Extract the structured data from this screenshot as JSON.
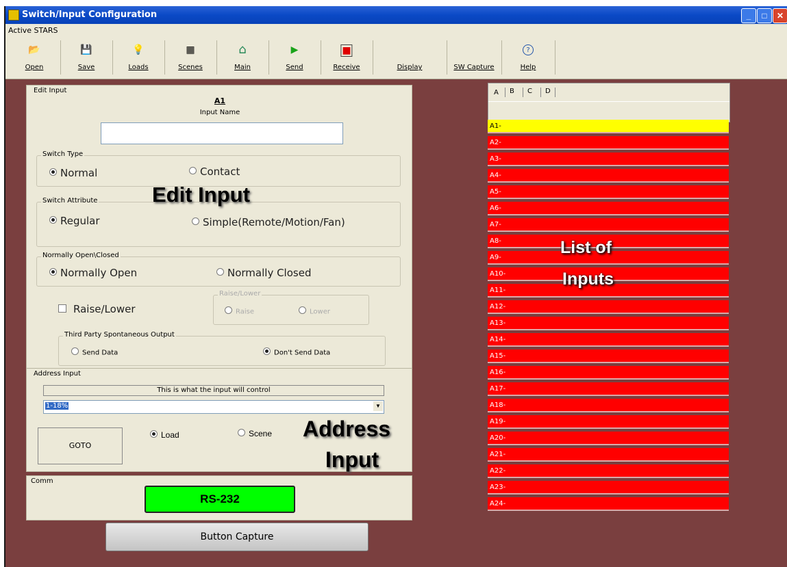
{
  "window": {
    "title": "Switch/Input Configuration",
    "menu_label": "Active STARS"
  },
  "toolbar": {
    "items": [
      {
        "label": "Open",
        "icon": "folder-open-icon",
        "glyph": "📂"
      },
      {
        "label": "Save",
        "icon": "floppy-icon",
        "glyph": "💾"
      },
      {
        "label": "Loads",
        "icon": "bulb-icon",
        "glyph": "💡"
      },
      {
        "label": "Scenes",
        "icon": "scenes-icon",
        "glyph": "▦"
      },
      {
        "label": "Main",
        "icon": "home-icon",
        "glyph": "⌂"
      },
      {
        "label": "Send",
        "icon": "play-icon",
        "glyph": "▶"
      },
      {
        "label": "Receive",
        "icon": "record-icon",
        "glyph": "■"
      },
      {
        "label": "Display",
        "icon": "",
        "glyph": ""
      },
      {
        "label": "SW Capture",
        "icon": "",
        "glyph": ""
      },
      {
        "label": "Help",
        "icon": "help-icon",
        "glyph": "?"
      }
    ]
  },
  "edit_input": {
    "group_title": "Edit Input",
    "input_id": "A1",
    "input_name_label": "Input Name",
    "input_name_value": "",
    "switch_type": {
      "title": "Switch Type",
      "options": [
        "Normal",
        "Contact"
      ],
      "selected": "Normal"
    },
    "switch_attribute": {
      "title": "Switch Attribute",
      "options": [
        "Regular",
        "Simple(Remote/Motion/Fan)"
      ],
      "selected": "Regular"
    },
    "normally": {
      "title": "Normally Open\\Closed",
      "options": [
        "Normally Open",
        "Normally Closed"
      ],
      "selected": "Normally Open"
    },
    "raise_lower_checkbox": "Raise/Lower",
    "raise_lower_group": {
      "title": "Raise/Lower",
      "options": [
        "Raise",
        "Lower"
      ]
    },
    "third_party": {
      "title": "Third Party Spontaneous Output",
      "options": [
        "Send Data",
        "Don't Send Data"
      ],
      "selected": "Don't Send Data"
    }
  },
  "address_input": {
    "group_title": "Address Input",
    "info": "This is what the input will control",
    "select_value": "1-18%",
    "goto_label": "GOTO",
    "options": [
      "Load",
      "Scene"
    ],
    "selected": "Load"
  },
  "comm": {
    "group_title": "Comm",
    "status": "RS-232",
    "status_color": "#00ff00"
  },
  "button_capture_label": "Button Capture",
  "list": {
    "tabs": [
      "A",
      "B",
      "C",
      "D"
    ],
    "selected_tab": "A",
    "items": [
      "A1-",
      "A2-",
      "A3-",
      "A4-",
      "A5-",
      "A6-",
      "A7-",
      "A8-",
      "A9-",
      "A10-",
      "A11-",
      "A12-",
      "A13-",
      "A14-",
      "A15-",
      "A16-",
      "A17-",
      "A18-",
      "A19-",
      "A20-",
      "A21-",
      "A22-",
      "A23-",
      "A24-"
    ],
    "selected_item": "A1-",
    "item_color": "#ff0000",
    "selected_color": "#ffff00"
  },
  "annotations": {
    "edit_input": "Edit Input",
    "address_input_line1": "Address",
    "address_input_line2": "Input",
    "list_line1": "List of",
    "list_line2": "Inputs"
  }
}
